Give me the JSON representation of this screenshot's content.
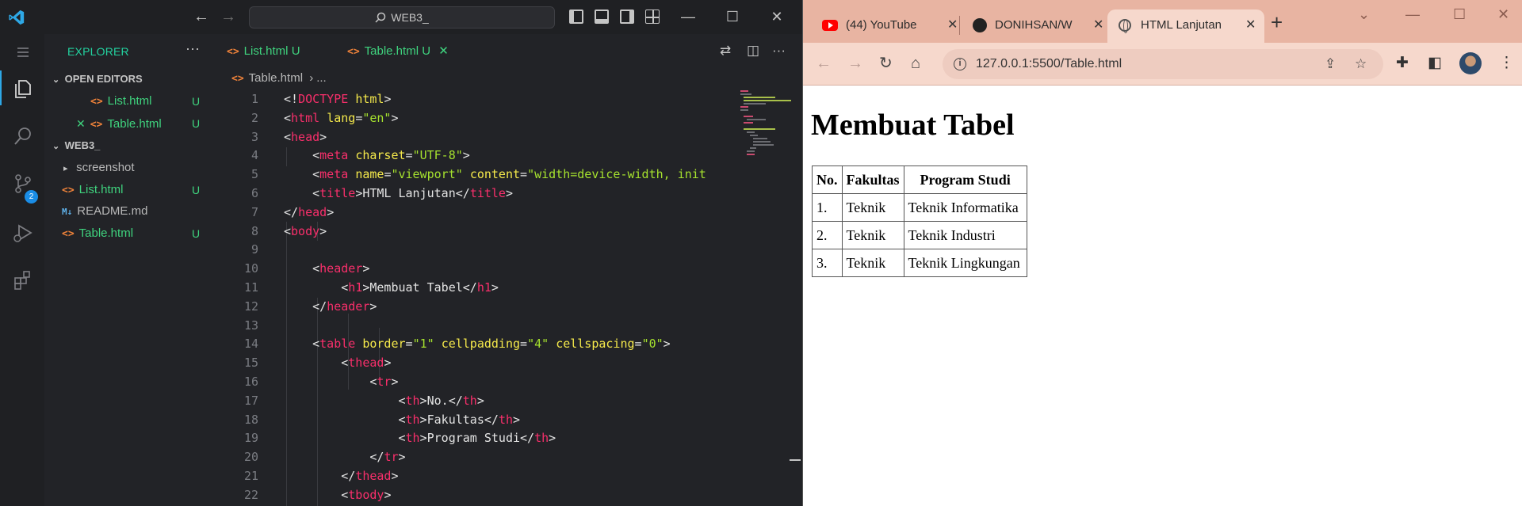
{
  "vscode": {
    "search_text": "WEB3_",
    "explorer_title": "EXPLORER",
    "open_editors_label": "OPEN EDITORS",
    "open_editors": [
      {
        "name": "List.html",
        "status": "U"
      },
      {
        "name": "Table.html",
        "status": "U"
      }
    ],
    "workspace_label": "WEB3_",
    "tree": [
      {
        "name": "screenshot",
        "status": ""
      },
      {
        "name": "List.html",
        "status": "U"
      },
      {
        "name": "README.md",
        "status": ""
      },
      {
        "name": "Table.html",
        "status": "U"
      }
    ],
    "source_control_badge": "2",
    "tabs": [
      {
        "name": "List.html",
        "status": "U"
      },
      {
        "name": "Table.html",
        "status": "U"
      }
    ],
    "breadcrumb": {
      "file": "Table.html",
      "rest": "..."
    },
    "code_lines": [
      {
        "n": "1"
      },
      {
        "n": "2"
      },
      {
        "n": "3"
      },
      {
        "n": "4"
      },
      {
        "n": "5"
      },
      {
        "n": "6"
      },
      {
        "n": "7"
      },
      {
        "n": "8"
      },
      {
        "n": "9"
      },
      {
        "n": "10"
      },
      {
        "n": "11"
      },
      {
        "n": "12"
      },
      {
        "n": "13"
      },
      {
        "n": "14"
      },
      {
        "n": "15"
      },
      {
        "n": "16"
      },
      {
        "n": "17"
      },
      {
        "n": "18"
      },
      {
        "n": "19"
      },
      {
        "n": "20"
      },
      {
        "n": "21"
      },
      {
        "n": "22"
      }
    ],
    "code": {
      "doctype": "DOCTYPE",
      "html_kw": "html",
      "html": "html",
      "lang_attr": "lang",
      "lang_val": "\"en\"",
      "head": "head",
      "meta": "meta",
      "charset_attr": "charset",
      "charset_val": "\"UTF-8\"",
      "name_attr": "name",
      "name_val": "\"viewport\"",
      "content_attr": "content",
      "content_val": "\"width=device-width, init",
      "title": "title",
      "title_text": "HTML Lanjutan",
      "body": "body",
      "header": "header",
      "h1": "h1",
      "h1_text": "Membuat Tabel",
      "table": "table",
      "border_attr": "border",
      "border_val": "\"1\"",
      "cellpadding_attr": "cellpadding",
      "cellpadding_val": "\"4\"",
      "cellspacing_attr": "cellspacing",
      "cellspacing_val": "\"0\"",
      "thead": "thead",
      "tr": "tr",
      "th": "th",
      "th1": "No.",
      "th2": "Fakultas",
      "th3": "Program Studi",
      "tbody": "tbody"
    }
  },
  "chrome": {
    "tabs": [
      {
        "title": "(44) YouTube"
      },
      {
        "title": "DONIHSAN/W"
      },
      {
        "title": "HTML Lanjutan"
      }
    ],
    "url": "127.0.0.1:5500/Table.html",
    "page": {
      "heading": "Membuat Tabel",
      "table": {
        "headers": [
          "No.",
          "Fakultas",
          "Program Studi"
        ],
        "rows": [
          [
            "1.",
            "Teknik",
            "Teknik Informatika"
          ],
          [
            "2.",
            "Teknik",
            "Teknik Industri"
          ],
          [
            "3.",
            "Teknik",
            "Teknik Lingkungan"
          ]
        ]
      }
    }
  },
  "colors": {
    "vscode_bg": "#222327",
    "accent_green": "#3fd37e",
    "tag_pink": "#f92f6b",
    "attr_yellow": "#f5e94b",
    "string_green": "#a6e22e",
    "chrome_tabstrip": "#e8b4a2",
    "chrome_toolbar": "#f6d8cc"
  }
}
